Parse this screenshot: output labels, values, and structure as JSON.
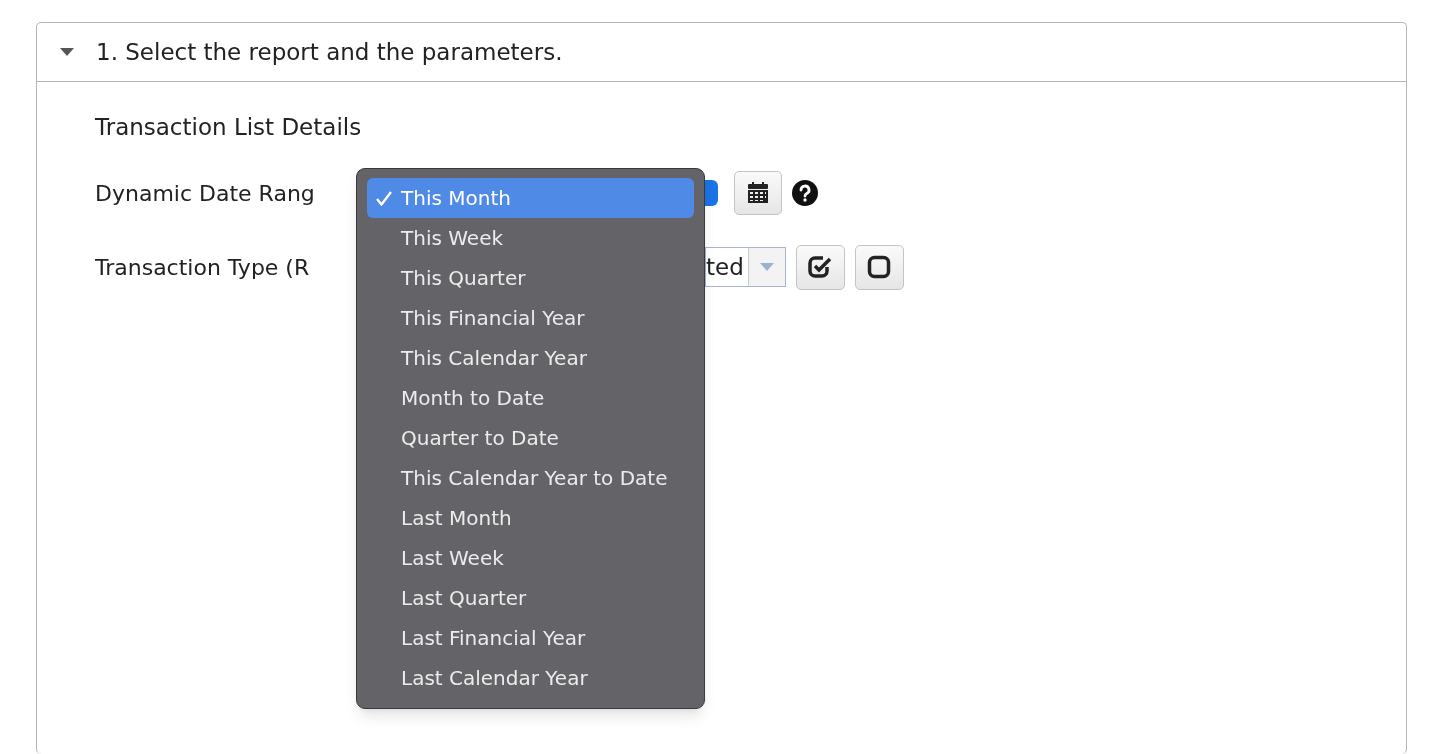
{
  "section": {
    "title": "1. Select the report and the parameters.",
    "expanded": true
  },
  "report_title": "Transaction List Details",
  "fields": [
    {
      "kind": "date-range",
      "label": "Dynamic Date Rang"
    },
    {
      "kind": "multi-select",
      "label": "Transaction Type (R",
      "value": "ted"
    }
  ],
  "dropdown": {
    "options": [
      {
        "label": "This Month",
        "selected": true
      },
      {
        "label": "This Week",
        "selected": false
      },
      {
        "label": "This Quarter",
        "selected": false
      },
      {
        "label": "This Financial Year",
        "selected": false
      },
      {
        "label": "This Calendar Year",
        "selected": false
      },
      {
        "label": "Month to Date",
        "selected": false
      },
      {
        "label": "Quarter to Date",
        "selected": false
      },
      {
        "label": "This Calendar Year to Date",
        "selected": false
      },
      {
        "label": "Last Month",
        "selected": false
      },
      {
        "label": "Last Week",
        "selected": false
      },
      {
        "label": "Last Quarter",
        "selected": false
      },
      {
        "label": "Last Financial Year",
        "selected": false
      },
      {
        "label": "Last Calendar Year",
        "selected": false
      }
    ]
  }
}
